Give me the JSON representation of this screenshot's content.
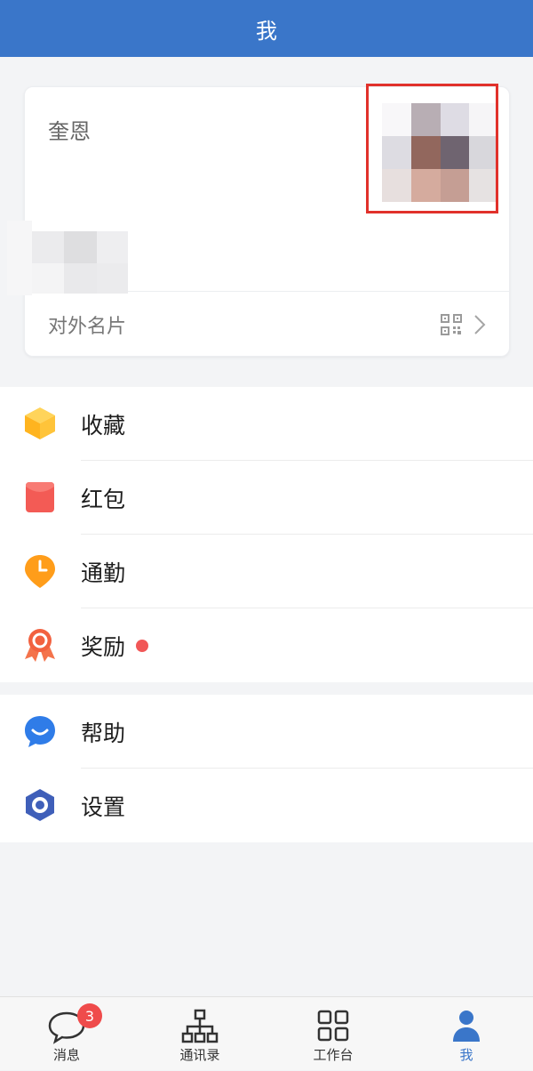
{
  "header": {
    "title": "我"
  },
  "profile": {
    "name": "奎恩",
    "card_label": "对外名片",
    "avatar_colors": [
      "#f8f7f9",
      "#b8aeb4",
      "#dedce4",
      "#f6f5f7",
      "#dddce2",
      "#92675d",
      "#6f6470",
      "#d8d7dc",
      "#e7dfde",
      "#d5ab9e",
      "#c59e94",
      "#e6e2e2"
    ],
    "blur_colors": [
      "#f3f3f5",
      "#e9e9eb",
      "#dfdfe1",
      "#ebebed",
      "#f5f5f6",
      "#efeff1",
      "#e9e9eb",
      "#ececee"
    ]
  },
  "menu_primary": [
    {
      "label": "收藏",
      "icon": "box-icon"
    },
    {
      "label": "红包",
      "icon": "red-envelope-icon"
    },
    {
      "label": "通勤",
      "icon": "clock-pin-icon"
    },
    {
      "label": "奖励",
      "icon": "award-ribbon-icon"
    }
  ],
  "menu_secondary": [
    {
      "label": "帮助",
      "icon": "chat-smile-icon"
    },
    {
      "label": "设置",
      "icon": "hexagon-gear-icon"
    }
  ],
  "tabbar": {
    "tabs": [
      {
        "label": "消息",
        "icon": "chat-bubble-icon",
        "badge": "3"
      },
      {
        "label": "通讯录",
        "icon": "org-chart-icon"
      },
      {
        "label": "工作台",
        "icon": "grid-icon"
      },
      {
        "label": "我",
        "icon": "person-icon",
        "active": true
      }
    ]
  },
  "colors": {
    "accent": "#3a76c9",
    "badge": "#ef4b4b"
  }
}
